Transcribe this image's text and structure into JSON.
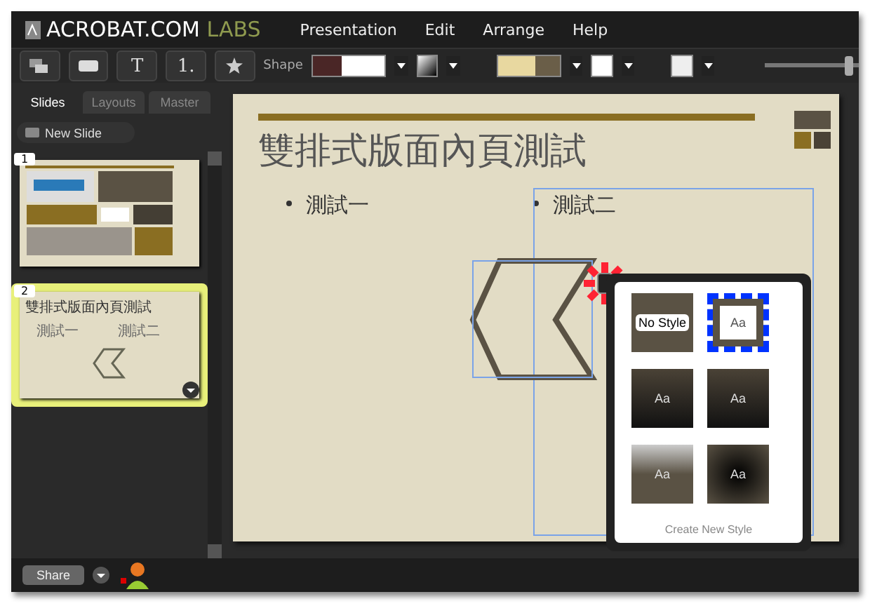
{
  "app": {
    "logo": "ACROBAT.COM",
    "logo_suffix": "LABS"
  },
  "menu": [
    "Presentation",
    "Edit",
    "Arrange",
    "Help"
  ],
  "toolbar": {
    "text_tool": "T",
    "number_tool": "1.",
    "shape_label": "Shape",
    "zoom": {
      "level": 0.9
    }
  },
  "panel_tabs": [
    {
      "label": "Slides",
      "selected": true
    },
    {
      "label": "Layouts",
      "selected": false
    },
    {
      "label": "Master",
      "selected": false
    }
  ],
  "new_slide": "New Slide",
  "slides": [
    {
      "number": "1",
      "selected": false,
      "kind": "blocks"
    },
    {
      "number": "2",
      "selected": true,
      "kind": "text",
      "title": "雙排式版面內頁測試",
      "bullets": [
        "測試一",
        "測試二"
      ]
    }
  ],
  "slide": {
    "title": "雙排式版面內頁測試",
    "bullets": [
      "測試一",
      "測試二"
    ]
  },
  "style_popup": {
    "styles": [
      {
        "label": "No Style",
        "kind": "none",
        "selected": false
      },
      {
        "label": "Aa",
        "kind": "framed",
        "selected": true
      },
      {
        "label": "Aa",
        "kind": "dark",
        "selected": false
      },
      {
        "label": "Aa",
        "kind": "dark",
        "selected": false
      },
      {
        "label": "Aa",
        "kind": "fade",
        "selected": false
      },
      {
        "label": "Aa",
        "kind": "glow",
        "selected": false
      }
    ],
    "create": "Create New Style"
  },
  "share": "Share"
}
